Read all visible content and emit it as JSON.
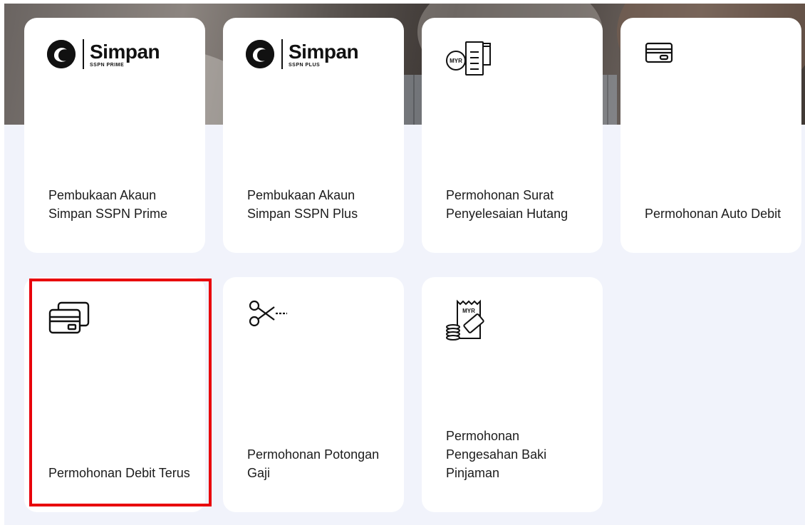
{
  "cards": [
    {
      "label": "Pembukaan Akaun Simpan SSPN Prime",
      "icon": "simpan-sspn-prime-logo",
      "logo_brand": "Simpan",
      "logo_sub": "SSPN PRIME"
    },
    {
      "label": "Pembukaan Akaun Simpan SSPN Plus",
      "icon": "simpan-sspn-plus-logo",
      "logo_brand": "Simpan",
      "logo_sub": "SSPN PLUS"
    },
    {
      "label": "Permohonan Surat Penyelesaian Hutang",
      "icon": "myr-document-icon",
      "icon_text": "MYR"
    },
    {
      "label": "Permohonan Auto Debit",
      "icon": "card-icon"
    },
    {
      "label": "Permohonan Debit Terus",
      "icon": "cards-icon",
      "highlighted": true
    },
    {
      "label": "Permohonan Potongan Gaji",
      "icon": "scissors-icon"
    },
    {
      "label": "Permohonan Pengesahan Baki Pinjaman",
      "icon": "myr-receipt-coins-icon",
      "icon_text": "MYR"
    }
  ],
  "colors": {
    "background": "#f1f3fb",
    "card": "#ffffff",
    "highlight": "#e8000b",
    "text": "#1c1c1c"
  }
}
